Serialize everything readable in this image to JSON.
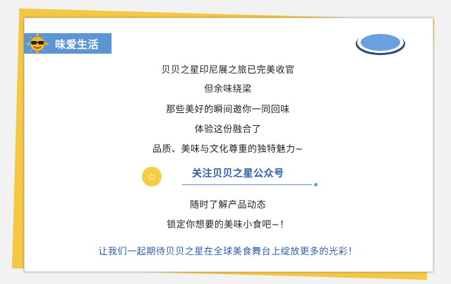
{
  "header": {
    "title": "味爱生活"
  },
  "intro_lines": [
    "贝贝之星印尼展之旅已完美收官",
    "但余味绕梁",
    "那些美好的瞬间邀你一同回味",
    "体验这份融合了",
    "品质、美味与文化尊重的独特魅力~"
  ],
  "follow": {
    "label": "关注贝贝之星公众号"
  },
  "follow_lines": [
    "随时了解产品动态",
    "锁定你想要的美味小食吧~！"
  ],
  "closing": "让我们一起期待贝贝之星在全球美食舞台上绽放更多的光彩！",
  "colors": {
    "accent_blue": "#5b95d3",
    "title_blue": "#2d5ea9",
    "yellow": "#f5c844"
  },
  "icons": {
    "badge": "sun-with-sunglasses-icon",
    "follow": "star-icon",
    "decor": "oval-ring-icon"
  }
}
